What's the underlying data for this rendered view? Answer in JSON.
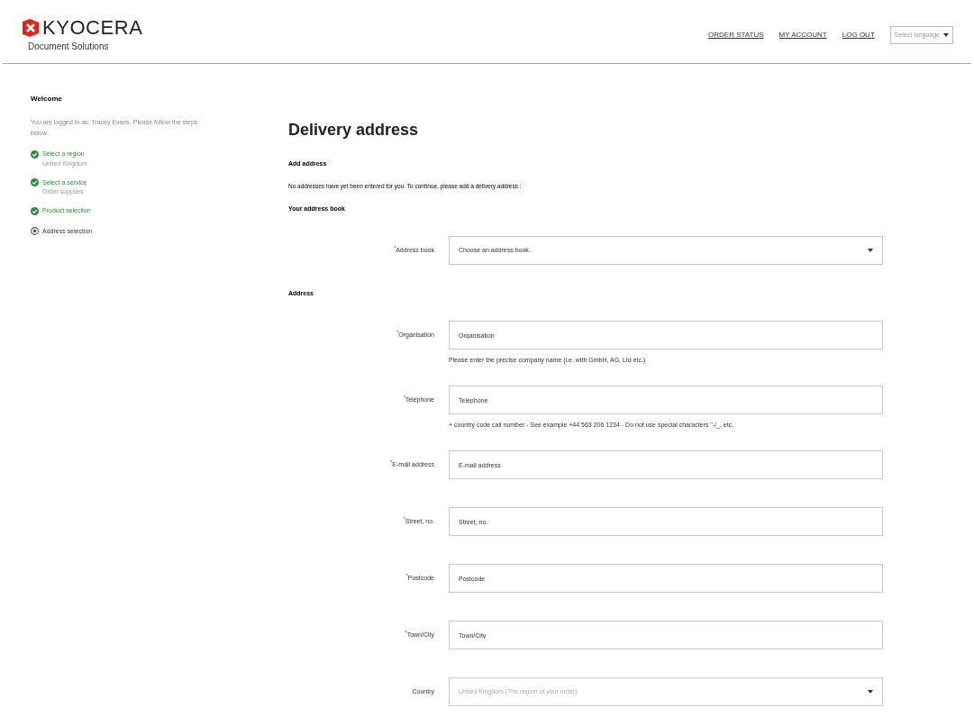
{
  "header": {
    "logo": {
      "wordmark": "KYOCERA",
      "tagline": "Document Solutions"
    },
    "nav_links": [
      "ORDER STATUS",
      "MY ACCOUNT",
      "LOG OUT"
    ],
    "language_select": {
      "value": "Select language"
    }
  },
  "sidebar": {
    "title": "Welcome",
    "intro": "You are logged in as: Tracey Evans. Please follow the steps below.",
    "steps": [
      {
        "label": "Select a region",
        "sublabel": "United Kingdom",
        "completed": true
      },
      {
        "label": "Select a service",
        "sublabel": "Order supplies",
        "completed": true
      },
      {
        "label": "Product selection",
        "completed": true
      },
      {
        "label": "Address selection",
        "completed": false
      }
    ]
  },
  "main": {
    "title": "Delivery address",
    "items": [
      {
        "kind": "section",
        "text": "Add address"
      },
      {
        "kind": "note",
        "text": "No addresses have yet been entered for you. To continue, please add a delivery address :"
      },
      {
        "kind": "section",
        "text": "Your address book"
      },
      {
        "kind": "select",
        "label": "$^{*}$Address book",
        "value": "Choose an address book..",
        "disabled": false
      },
      {
        "kind": "section",
        "text": "Address"
      },
      {
        "kind": "input",
        "label": "$^{*}$Organisation",
        "placeholder": "Organisation",
        "hint": "Please enter the precise company name (i.e. with GmbH, AG, Ltd etc.)"
      },
      {
        "kind": "input",
        "label": "$^{*}$Telephone",
        "placeholder": "Telephone",
        "hint": "+ country code call number - See example +44 563 206 1234 - Do not use special characters \"-/_, etc."
      },
      {
        "kind": "input",
        "label": "$^{*}$E-mail address",
        "placeholder": "E-mail address"
      },
      {
        "kind": "input",
        "label": "$^{*}$Street, no.",
        "placeholder": "Street, no."
      },
      {
        "kind": "input",
        "label": "$^{*}$Postcode",
        "placeholder": "Postcode"
      },
      {
        "kind": "input",
        "label": "$^{*}$Town/City",
        "placeholder": "Town/City"
      },
      {
        "kind": "select",
        "label": "Country",
        "value": "United Kingdom (The region of your order)",
        "disabled": true
      }
    ]
  }
}
